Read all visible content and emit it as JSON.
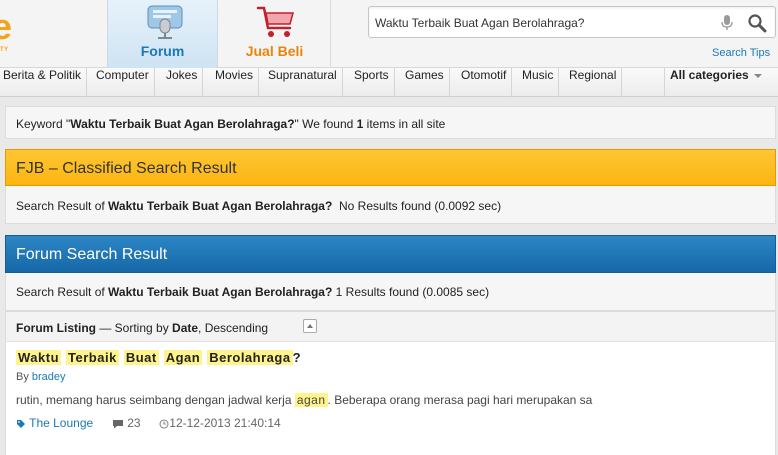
{
  "header": {
    "logo_tagline": "TY",
    "tabs": [
      {
        "label": "Forum",
        "icon": "microphone-icon",
        "active": true
      },
      {
        "label": "Jual Beli",
        "icon": "shopping-cart-icon",
        "active": false
      }
    ],
    "search": {
      "value": "Waktu Terbaik Buat Agan Berolahraga?",
      "tips_label": "Search Tips"
    }
  },
  "categories": {
    "items": [
      "Berita & Politik",
      "Computer",
      "Jokes",
      "Movies",
      "Supranatural",
      "Sports",
      "Games",
      "Otomotif",
      "Music",
      "Regional"
    ],
    "all_label": "All categories"
  },
  "keyword_summary": {
    "prefix": "Keyword \"",
    "query": "Waktu Terbaik Buat Agan Berolahraga?",
    "middle": "\" We found ",
    "count": "1",
    "suffix": " items in all site"
  },
  "fjb": {
    "title": "FJB – Classified Search Result",
    "prefix": "Search Result of ",
    "query": "Waktu Terbaik Buat Agan Berolahraga?",
    "result_text": "  No Results found (0.0092 sec)"
  },
  "forum": {
    "title": "Forum Search Result",
    "prefix": "Search Result of ",
    "query": "Waktu Terbaik Buat Agan Berolahraga?",
    "result_text": " 1 Results found (0.0085 sec)",
    "listing": {
      "label": "Forum Listing",
      "sort_text": " — Sorting by ",
      "sort_field": "Date",
      "sort_order": ", Descending"
    },
    "results": [
      {
        "title_words": [
          "Waktu",
          "Terbaik",
          "Buat",
          "Agan",
          "Berolahraga"
        ],
        "title_end": "?",
        "by_label": "By ",
        "author": "bradey",
        "snippet_before": "rutin, memang harus seimbang dengan jadwal kerja ",
        "snippet_highlight": "agan",
        "snippet_after": ". Beberapa orang merasa pagi hari merupakan sa",
        "category": "The Lounge",
        "comments": "23",
        "date": "12-12-2013 21:40:14"
      }
    ]
  },
  "colors": {
    "accent_blue": "#1c78b9",
    "fjb_orange": "#fbb511",
    "highlight": "#fff48b",
    "jual_beli_orange": "#e8850c"
  }
}
